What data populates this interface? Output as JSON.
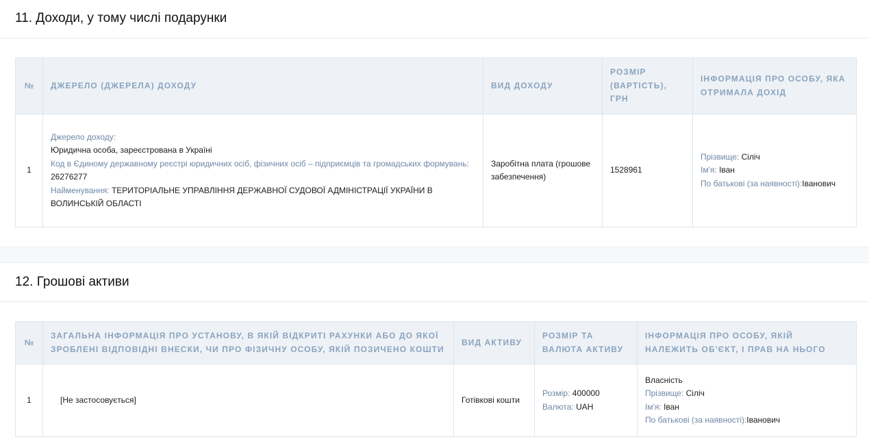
{
  "income": {
    "title": "11. Доходи, у тому числі подарунки",
    "headers": {
      "num": "№",
      "source": "Джерело (джерела) доходу",
      "type": "Вид доходу",
      "amount": "Розмір (вартість), грн",
      "person": "Інформація про особу, яка отримала дохід"
    },
    "row": {
      "num": "1",
      "source_label": "Джерело доходу:",
      "source_kind": "Юридична особа, зареєстрована в Україні",
      "code_label": "Код в Єдиному державному реєстрі юридичних осіб, фізичних осіб – підприємців та громадських формувань:",
      "code_value": "26276277",
      "name_label": "Найменування:",
      "name_value": "ТЕРИТОРІАЛЬНЕ УПРАВЛІННЯ ДЕРЖАВНОЇ СУДОВОЇ АДМІНІСТРАЦІЇ УКРАЇНИ В ВОЛИНСЬКІЙ ОБЛАСТІ",
      "type": "Заробітна плата (грошове забезпечення)",
      "amount": "1528961",
      "surname_label": "Прізвище:",
      "surname": "Сіліч",
      "firstname_label": "Ім'я:",
      "firstname": "Іван",
      "patronymic_label": "По батькові (за наявності):",
      "patronymic": "Іванович"
    }
  },
  "cash": {
    "title": "12. Грошові активи",
    "headers": {
      "num": "№",
      "institution": "Загальна інформація про установу, в якій відкриті рахунки або до якої зроблені відповідні внески, чи про фізичну особу, якій позичено кошти",
      "type": "Вид активу",
      "amount": "Розмір та валюта активу",
      "person": "Інформація про особу, якій належить об'єкт, і прав на нього"
    },
    "row": {
      "num": "1",
      "institution": "[Не застосовується]",
      "type": "Готівкові кошти",
      "size_label": "Розмір:",
      "size_value": "400000",
      "currency_label": "Валюта:",
      "currency_value": "UAH",
      "ownership": "Власність",
      "surname_label": "Прізвище:",
      "surname": "Сіліч",
      "firstname_label": "Ім'я:",
      "firstname": "Іван",
      "patronymic_label": "По батькові (за наявності):",
      "patronymic": "Іванович"
    }
  }
}
